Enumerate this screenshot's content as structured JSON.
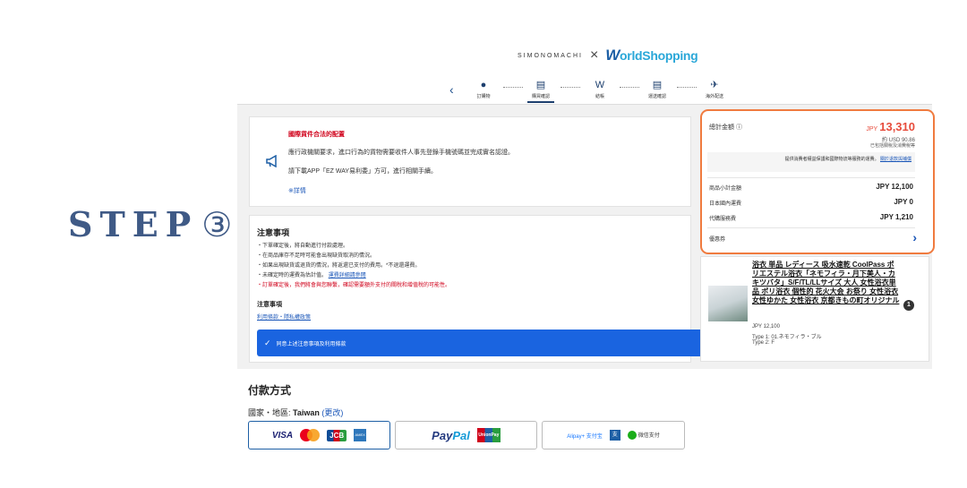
{
  "step_label": {
    "word": "STEP",
    "number": "③"
  },
  "header": {
    "shop_name": "SIMONOMACHI",
    "times": "×",
    "ws_w": "W",
    "ws_rest": "orldShopping"
  },
  "stepper": {
    "back": "‹",
    "steps": [
      {
        "label": "訂購物",
        "icon": "●"
      },
      {
        "label": "購買確認",
        "icon": "▤"
      },
      {
        "label": "結帳",
        "icon": "W"
      },
      {
        "label": "運送確認",
        "icon": "▤"
      },
      {
        "label": "海外配送",
        "icon": "✈"
      }
    ]
  },
  "notice": {
    "title": "國際貨件合法的配置",
    "line1": "應行政機關要求，進口行為的貨物需要收件人事先登錄手機號碼並完成實名認證。",
    "line2": "請下載APP「EZ WAY易利委」方可，進行相關手續。",
    "more": "※詳情"
  },
  "notes": {
    "heading": "注意事項",
    "lines": [
      "・下單確定後，將自動進行付款處理。",
      "・在商品庫存不足時可能會出現缺貨取消的情況。",
      "・如果出現缺貨或退貨的情況，將返還已支付的費用。*不退還運費。",
      "・未確定時的運費為估計值。"
    ],
    "line4_link": "運費詳細請參閱",
    "red_line": "・訂單確定後，我們將會與您聯繫，確認需要額外支付的關稅和增值稅的可能性。",
    "sub_heading": "注意事項",
    "terms_link": "利用條款・隱私權政策",
    "agree_check": "✓",
    "agree_text": "同意上述注意事項及利用條款"
  },
  "summary": {
    "total_label": "總計金額 ⓘ",
    "total_currency": "JPY",
    "total_value": "13,310",
    "usd": "約 USD 90.86",
    "incl": "已包括關稅及消費稅等",
    "pass_text": "提供消費者權益保護和國際物流等服務的運費。",
    "pass_link": "關於退款與補償",
    "rows": [
      {
        "label": "商品小計金額",
        "value": "JPY 12,100"
      },
      {
        "label": "日本國內運費",
        "value": "JPY 0"
      },
      {
        "label": "代購服務費",
        "value": "JPY 1,210"
      }
    ],
    "coupon_label": "優惠券",
    "coupon_chev": "›"
  },
  "product": {
    "name": "浴衣 単品 レディース 吸水速乾 CoolPass ポリエステル浴衣「ネモフィラ・月下美人・カキツバタ」S/F/TL/LLサイズ 大人 女性浴衣単品 ポリ浴衣 個性的 花火大会 お祭り 女性浴衣 女性ゆかた 女性浴衣 京都きもの町オリジナル",
    "price": "JPY 12,100",
    "type1": "Type 1: 01.ネモフィラ・ブル",
    "type2": "Type 2: F",
    "qty": "1"
  },
  "payment": {
    "heading": "付款方式",
    "region_label": "國家・地區:",
    "region_value": "Taiwan",
    "region_change": "(更改)",
    "cards": {
      "visa": "VISA",
      "jcb": "JCB",
      "amex": "AMEX",
      "paypal_1": "Pay",
      "paypal_2": "Pal",
      "unionpay": "UnionPay",
      "alipay": "Alipay+ 支付宝",
      "qr": "支",
      "wechat": "微信支付"
    }
  }
}
